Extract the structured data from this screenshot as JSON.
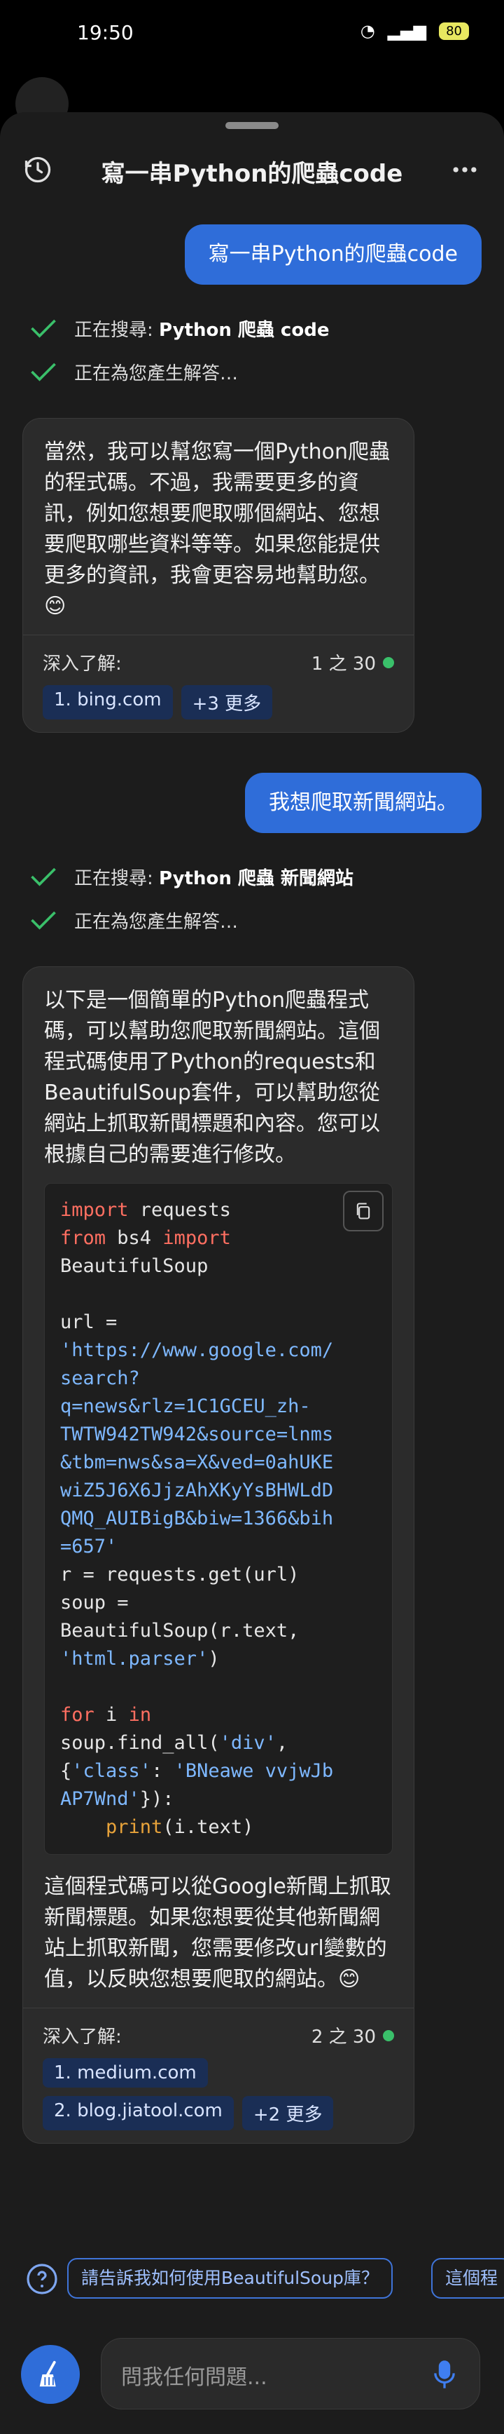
{
  "status_bar": {
    "time": "19:50",
    "battery": "80"
  },
  "header": {
    "title": "寫一串Python的爬蟲code"
  },
  "conversation": {
    "q1": "寫一串Python的爬蟲code",
    "s1a_prefix": "正在搜尋: ",
    "s1a_bold": "Python 爬蟲 code",
    "s1b": "正在為您產生解答…",
    "a1": "當然，我可以幫您寫一個Python爬蟲的程式碼。不過，我需要更多的資訊，例如您想要爬取哪個網站、您想要爬取哪些資料等等。如果您能提供更多的資訊，我會更容易地幫助您。😊",
    "a1_learn": "深入了解:",
    "a1_count": "1 之 30",
    "a1_chips": [
      "1. bing.com",
      "+3 更多"
    ],
    "q2": "我想爬取新聞網站。",
    "s2a_prefix": "正在搜尋: ",
    "s2a_bold": "Python 爬蟲 新聞網站",
    "s2b": "正在為您產生解答…",
    "a2_intro": "以下是一個簡單的Python爬蟲程式碼，可以幫助您爬取新聞網站。這個程式碼使用了Python的requests和BeautifulSoup套件，可以幫助您從網站上抓取新聞標題和內容。您可以根據自己的需要進行修改。",
    "a2_outro": "這個程式碼可以從Google新聞上抓取新聞標題。如果您想要從其他新聞網站上抓取新聞，您需要修改url變數的值，以反映您想要爬取的網站。😊",
    "a2_learn": "深入了解:",
    "a2_count": "2 之 30",
    "a2_chips": [
      "1. medium.com",
      "2. blog.jiatool.com",
      "+2 更多"
    ]
  },
  "code": {
    "import": "import",
    "requests": " requests",
    "from": "from",
    "bs4": " bs4 ",
    "import2": "import",
    "bs_line": "BeautifulSoup",
    "url_eq": "url =",
    "url_str": "'https://www.google.com/\nsearch?\nq=news&rlz=1C1GCEU_zh-\nTWTW942TW942&source=lnms\n&tbm=nws&sa=X&ved=0ahUKE\nwiZ5J6X6JjzAhXKyYsBHWLdD\nQMQ_AUIBigB&biw=1366&bih\n=657'",
    "req_line": "r = requests.get(url)",
    "soup_eq": "soup =",
    "soup_call": "BeautifulSoup(r.text,",
    "parser": "'html.parser'",
    "parser_close": ")",
    "for": "for",
    "i": " i ",
    "in": "in",
    "find_all": "soup.find_all(",
    "div": "'div'",
    "find_comma": ",",
    "brace_open": "{",
    "class_key": "'class'",
    "colon": ": ",
    "class_val": "'BNeawe vvjwJb\nAP7Wnd'",
    "brace_close": "}):",
    "indent": "    ",
    "print": "print",
    "print_args": "(i.text)"
  },
  "suggestions": [
    "請告訴我如何使用BeautifulSoup庫？",
    "這個程"
  ],
  "input": {
    "placeholder": "問我任何問題..."
  },
  "colors": {
    "accent": "#2f6dd9",
    "green": "#3ac06a",
    "chip_bg": "#1a2e55"
  }
}
